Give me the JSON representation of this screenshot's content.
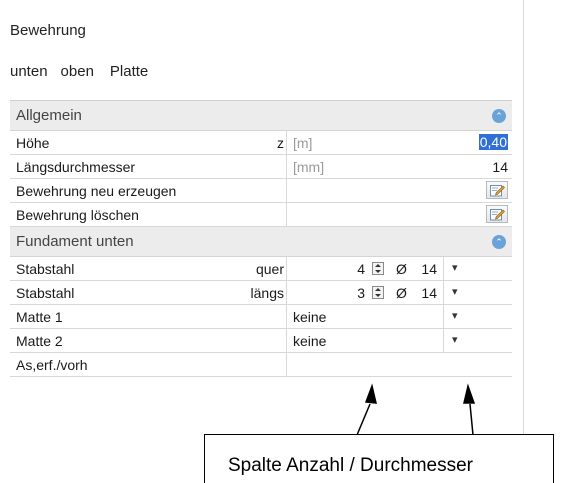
{
  "panel": {
    "title": "Bewehrung",
    "tabs": [
      "unten",
      "oben",
      "Platte"
    ]
  },
  "groups": {
    "allgemein": {
      "label": "Allgemein",
      "rows": {
        "hoehe": {
          "name": "Höhe",
          "symbol": "z",
          "unit": "[m]",
          "value": "0,40"
        },
        "laengsdurchmesser": {
          "name": "Längsdurchmesser",
          "unit": "[mm]",
          "value": "14"
        },
        "neu": {
          "name": "Bewehrung neu erzeugen"
        },
        "loeschen": {
          "name": "Bewehrung löschen"
        }
      }
    },
    "fundament": {
      "label": "Fundament unten",
      "rows": {
        "quer": {
          "name": "Stabstahl",
          "dir": "quer",
          "count": "4",
          "diam_symbol": "Ø",
          "diameter": "14"
        },
        "laengs": {
          "name": "Stabstahl",
          "dir": "längs",
          "count": "3",
          "diam_symbol": "Ø",
          "diameter": "14"
        },
        "matte1": {
          "name": "Matte 1",
          "value": "keine"
        },
        "matte2": {
          "name": "Matte 2",
          "value": "keine"
        },
        "as": {
          "name": "As,erf./vorh"
        }
      }
    }
  },
  "callout": {
    "text": "Spalte  Anzahl / Durchmesser"
  },
  "colors": {
    "selection": "#2f6fd6",
    "category_bg": "#ececec",
    "collapse_icon": "#6aa3d8"
  }
}
